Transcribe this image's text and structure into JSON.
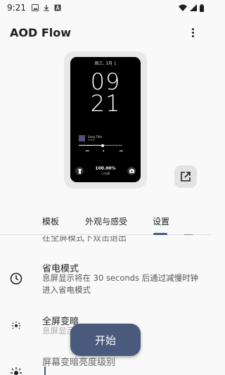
{
  "status_bar": {
    "time": "9:21"
  },
  "app_bar": {
    "title": "AOD Flow"
  },
  "preview": {
    "date": "周三, 3月 1",
    "hour": "09",
    "minute": "21",
    "media": {
      "title": "Song Title",
      "artist": "Artist",
      "progress": 0.55
    },
    "battery": "100.00%",
    "battery_status": "已充满"
  },
  "tabs": [
    {
      "label": "模板",
      "selected": false
    },
    {
      "label": "外观与感受",
      "selected": false
    },
    {
      "label": "设置",
      "selected": true
    }
  ],
  "settings": {
    "partial_text": "在全屏模式下双击退出",
    "power_saving": {
      "title": "省电模式",
      "desc": "息屏显示将在 30 seconds 后通过减慢时钟进入省电模式"
    },
    "full_dim": {
      "title": "全屏变暗",
      "desc": "息屏显示将在……"
    },
    "dim_level": {
      "title": "屏幕变暗亮度级别"
    }
  },
  "fab": {
    "label": "开始"
  },
  "colors": {
    "accent": "#4a5a7d",
    "background": "#f9f9f9"
  }
}
